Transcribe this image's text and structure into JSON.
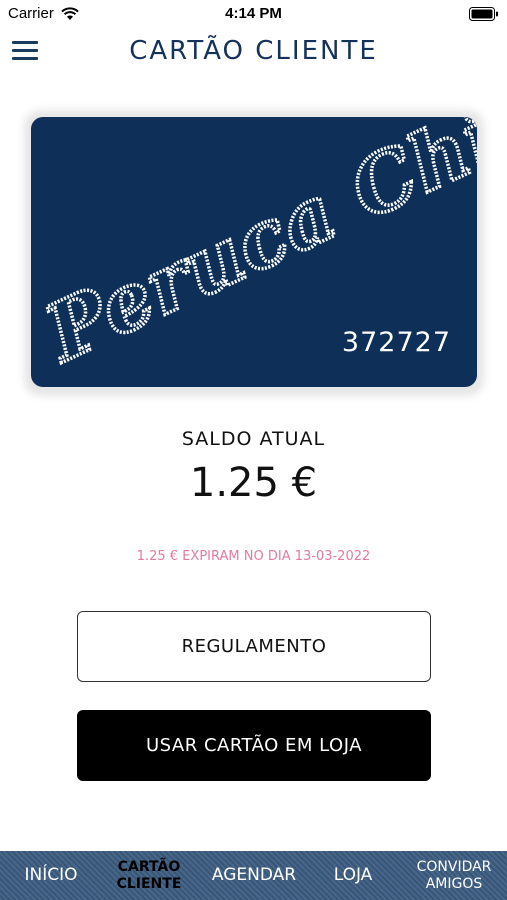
{
  "status_bar": {
    "carrier": "Carrier",
    "time": "4:14 PM"
  },
  "header": {
    "title": "CARTÃO CLIENTE",
    "menu_icon": "hamburger-menu-icon"
  },
  "card": {
    "brand": "Peruca Chic",
    "number": "372727",
    "background_color": "#0e2f57"
  },
  "balance": {
    "label": "SALDO ATUAL",
    "value": "1.25 €"
  },
  "expiry": {
    "text": "1.25 € EXPIRAM NO DIA 13-03-2022",
    "color": "#e57aa0"
  },
  "buttons": {
    "rules_label": "REGULAMENTO",
    "use_card_label": "USAR CARTÃO EM LOJA"
  },
  "tab_bar": {
    "active": "CARTÃO CLIENTE",
    "items": [
      {
        "label": "INÍCIO"
      },
      {
        "line1": "CARTÃO",
        "line2": "CLIENTE"
      },
      {
        "label": "AGENDAR"
      },
      {
        "label": "LOJA"
      },
      {
        "line1": "CONVIDAR",
        "line2": "AMIGOS"
      }
    ]
  }
}
